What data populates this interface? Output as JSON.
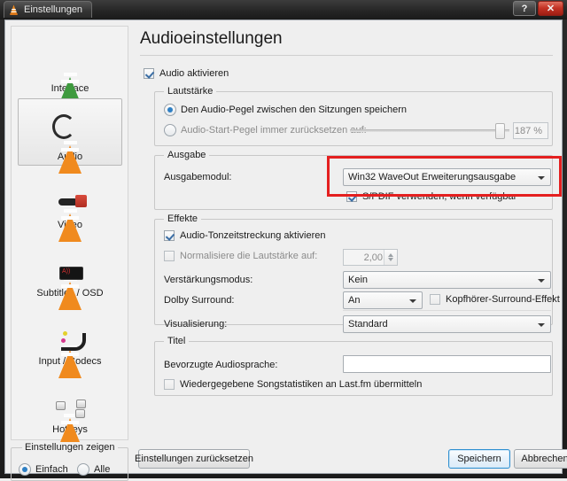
{
  "window": {
    "title": "Einstellungen",
    "help_label": "?",
    "close_label": "✕"
  },
  "sidebar": {
    "items": [
      {
        "label": "Interface",
        "icon": "vlc-cone-icon",
        "selected": false
      },
      {
        "label": "Audio",
        "icon": "vlc-cone-headphones-icon",
        "selected": true
      },
      {
        "label": "Video",
        "icon": "vlc-cone-glasses-icon",
        "selected": false
      },
      {
        "label": "Subtitles / OSD",
        "icon": "vlc-cone-display-icon",
        "selected": false
      },
      {
        "label": "Input / Codecs",
        "icon": "vlc-cone-cables-icon",
        "selected": false
      },
      {
        "label": "Hotkeys",
        "icon": "vlc-cone-keys-icon",
        "selected": false
      }
    ],
    "show_settings": {
      "title": "Einstellungen zeigen",
      "simple_label": "Einfach",
      "all_label": "Alle",
      "selected": "Einfach"
    }
  },
  "main": {
    "page_title": "Audioeinstellungen",
    "audio_enabled": {
      "label": "Audio aktivieren",
      "checked": true
    },
    "volume_group": {
      "title": "Lautstärke",
      "save_level_label": "Den Audio-Pegel zwischen den Sitzungen speichern",
      "save_level_selected": true,
      "reset_level_label": "Audio-Start-Pegel immer zurücksetzen auf:",
      "reset_level_selected": false,
      "slider_value": 187,
      "slider_value_text": "187 %",
      "slider_min": 0,
      "slider_max": 200
    },
    "output_group": {
      "title": "Ausgabe",
      "module_label": "Ausgabemodul:",
      "module_value": "Win32 WaveOut Erweiterungsausgabe",
      "spdif_label": "S/PDIF verwenden, wenn verfügbar",
      "spdif_checked": true,
      "highlight_color": "#e41f1f"
    },
    "effects_group": {
      "title": "Effekte",
      "timestretch_label": "Audio-Tonzeitstreckung aktivieren",
      "timestretch_checked": true,
      "normalize_label": "Normalisiere die Lautstärke auf:",
      "normalize_checked": false,
      "normalize_value": "2,00",
      "gain_label": "Verstärkungsmodus:",
      "gain_value": "Kein",
      "dolby_label": "Dolby Surround:",
      "dolby_value": "An",
      "headphone_label": "Kopfhörer-Surround-Effekt",
      "headphone_checked": false,
      "visual_label": "Visualisierung:",
      "visual_value": "Standard"
    },
    "track_group": {
      "title": "Titel",
      "language_label": "Bevorzugte Audiosprache:",
      "language_value": "",
      "lastfm_label": "Wiedergegebene Songstatistiken an Last.fm übermitteln",
      "lastfm_checked": false
    }
  },
  "footer": {
    "reset_label": "Einstellungen zurücksetzen",
    "save_label": "Speichern",
    "cancel_label": "Abbrechen"
  }
}
